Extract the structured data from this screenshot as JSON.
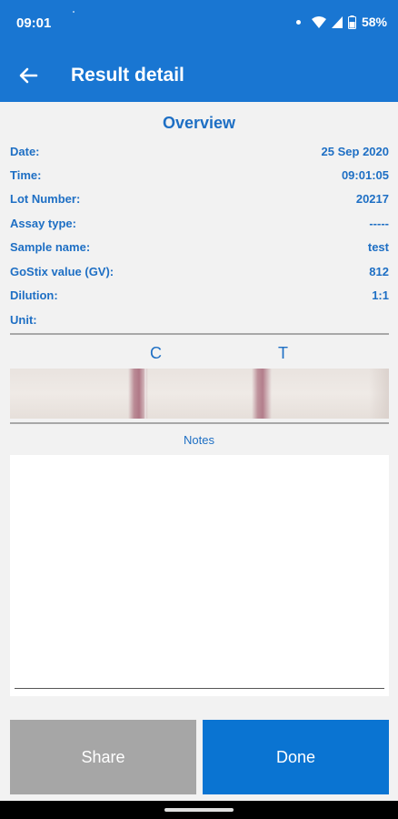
{
  "status_bar": {
    "time": "09:01",
    "battery": "58%",
    "icons": [
      "notification-dot-icon",
      "wifi-icon",
      "signal-icon",
      "battery-icon"
    ]
  },
  "app_bar": {
    "back_icon": "arrow-left-icon",
    "title": "Result detail",
    "color": "#1976d2"
  },
  "overview": {
    "title": "Overview",
    "rows": [
      {
        "label": "Date:",
        "value": "25 Sep 2020"
      },
      {
        "label": "Time:",
        "value": "09:01:05"
      },
      {
        "label": "Lot Number:",
        "value": "20217"
      },
      {
        "label": "Assay type:",
        "value": "-----"
      },
      {
        "label": "Sample name:",
        "value": "test"
      },
      {
        "label": "GoStix value (GV):",
        "value": "812"
      },
      {
        "label": "Dilution:",
        "value": "1:1"
      },
      {
        "label": "Unit:",
        "value": ""
      }
    ]
  },
  "strip": {
    "c_label": "C",
    "t_label": "T"
  },
  "notes": {
    "label": "Notes",
    "value": ""
  },
  "buttons": {
    "share": "Share",
    "done": "Done"
  },
  "colors": {
    "accent": "#1976d2",
    "text_blue": "#1e6fc4",
    "share_gray": "#a6a6a6",
    "done_blue": "#0a74d2"
  }
}
